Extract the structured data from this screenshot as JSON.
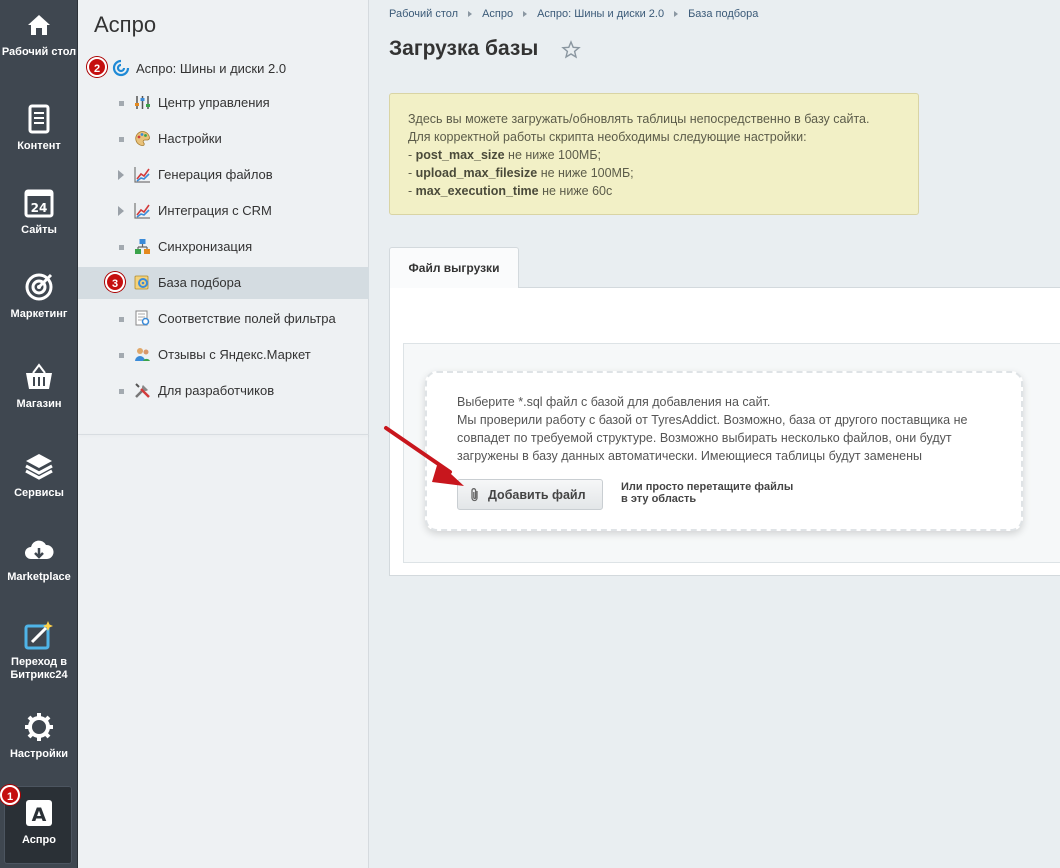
{
  "rail": {
    "items": [
      {
        "label": "Рабочий стол",
        "icon": "home-icon"
      },
      {
        "label": "Контент",
        "icon": "document-icon"
      },
      {
        "label": "Сайты",
        "icon": "calendar-24-icon"
      },
      {
        "label": "Маркетинг",
        "icon": "target-icon"
      },
      {
        "label": "Магазин",
        "icon": "basket-icon"
      },
      {
        "label": "Сервисы",
        "icon": "layers-icon"
      },
      {
        "label": "Marketplace",
        "icon": "cloud-download-icon"
      },
      {
        "label": "Переход в Битрикс24",
        "icon": "magic-wand-icon"
      },
      {
        "label": "Настройки",
        "icon": "gear-icon"
      },
      {
        "label": "Аспро",
        "icon": "aspro-a-icon"
      }
    ],
    "badge_1": "1"
  },
  "menu": {
    "title": "Аспро",
    "root_label": "Аспро: Шины и диски 2.0",
    "badge_2": "2",
    "badge_3": "3",
    "items": [
      {
        "label": "Центр управления"
      },
      {
        "label": "Настройки"
      },
      {
        "label": "Генерация файлов"
      },
      {
        "label": "Интеграция с CRM"
      },
      {
        "label": "Синхронизация"
      },
      {
        "label": "База подбора"
      },
      {
        "label": "Соответствие полей фильтра"
      },
      {
        "label": "Отзывы с Яндекс.Маркет"
      },
      {
        "label": "Для разработчиков"
      }
    ]
  },
  "breadcrumb": [
    "Рабочий стол",
    "Аспро",
    "Аспро: Шины и диски 2.0",
    "База подбора"
  ],
  "page": {
    "title": "Загрузка базы"
  },
  "notice": {
    "line1": "Здесь вы можете загружать/обновлять таблицы непосредственно в базу сайта.",
    "line2": "Для корректной работы скрипта необходимы следующие настройки:",
    "s1_name": "post_max_size",
    "s1_value": " не ниже 100МБ;",
    "s2_name": "upload_max_filesize",
    "s2_value": " не ниже 100МБ;",
    "s3_name": "max_execution_time",
    "s3_value": " не ниже 60с"
  },
  "tab": {
    "label": "Файл выгрузки"
  },
  "upload": {
    "line1": "Выберите *.sql файл с базой для добавления на сайт.",
    "line2": "Мы проверили работу с базой от TyresAddict. Возможно, база от другого поставщика не совпадет по требуемой структуре. Возможно выбирать несколько файлов, они будут загружены в базу данных автоматически. Имеющиеся таблицы будут заменены",
    "button_label": "Добавить файл",
    "hint_line1": "Или просто перетащите файлы",
    "hint_line2": "в эту область"
  },
  "colors": {
    "rail_bg": "#3f4750",
    "badge_red": "#c50f0f",
    "notice_bg": "#f2f0c6"
  }
}
